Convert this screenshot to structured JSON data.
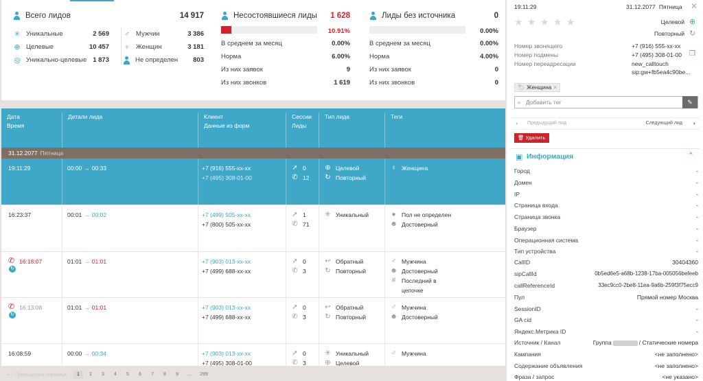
{
  "stats": {
    "col1": {
      "title": "Всего лидов",
      "total": "14 917",
      "left": [
        {
          "label": "Уникальные",
          "value": "2 569",
          "icon": "asterisk-icon"
        },
        {
          "label": "Целевые",
          "value": "10 457",
          "icon": "target-icon"
        },
        {
          "label": "Уникально-целевые",
          "value": "1 873",
          "icon": "unique-target-icon"
        }
      ],
      "right": [
        {
          "label": "Мужчин",
          "value": "3 386",
          "icon": "male-icon"
        },
        {
          "label": "Женщин",
          "value": "3 181",
          "icon": "female-icon"
        },
        {
          "label": "Не определен",
          "value": "803",
          "icon": "person-icon"
        }
      ]
    },
    "col2": {
      "title": "Несостоявшиеся лиды",
      "total": "1 628",
      "percent": "10.91%",
      "bar_fraction": 0.1091,
      "items": [
        {
          "label": "В среднем за месяц",
          "value": "0.00%"
        },
        {
          "label": "Норма",
          "value": "6.00%"
        },
        {
          "label": "Из них заявок",
          "value": "9"
        },
        {
          "label": "Из них звонков",
          "value": "1 619"
        }
      ]
    },
    "col3": {
      "title": "Лиды без источника",
      "total": "0",
      "percent": "0.00%",
      "bar_fraction": 0,
      "items": [
        {
          "label": "В среднем за месяц",
          "value": "0.00%"
        },
        {
          "label": "Норма",
          "value": "4.00%"
        },
        {
          "label": "Из них заявок",
          "value": "0"
        },
        {
          "label": "Из них звонков",
          "value": "0"
        }
      ]
    }
  },
  "table": {
    "headers": {
      "date_time": [
        "Дата",
        "Время"
      ],
      "details": "Детали лида",
      "client": [
        "Клиент",
        "Данные из форм"
      ],
      "sessions": [
        "Сессии",
        "Лиды"
      ],
      "type": "Тип лида",
      "tags": "Теги"
    },
    "day": {
      "date": "31.12.2077",
      "weekday": "Пятница"
    },
    "rows": [
      {
        "time": "19:11:29",
        "missed": false,
        "dur_a": "00:00",
        "dur_b": "00:33",
        "dur_b_red": false,
        "phone1": "+7 (916) 555-xx-xx",
        "phone2": "+7 (495) 308-01-00",
        "sessions": "0",
        "calls": "12",
        "types": [
          {
            "icon": "target-icon",
            "label": "Целевой"
          },
          {
            "icon": "repeat-icon",
            "label": "Повторный"
          }
        ],
        "tags": [
          {
            "icon": "female-icon",
            "label": "Женщина"
          }
        ]
      },
      {
        "time": "16:23:37",
        "missed": false,
        "dur_a": "00:01",
        "dur_b": "00:02",
        "dur_b_red": false,
        "phone1": "+7 (499) 505-xx-xx",
        "phone2": "+7 (800) 505-xx-xx",
        "sessions": "1",
        "calls": "71",
        "types": [
          {
            "icon": "asterisk-icon",
            "label": "Уникальный"
          }
        ],
        "tags": [
          {
            "icon": "person-icon",
            "label": "Пол не определен"
          },
          {
            "icon": "robot-icon",
            "label": "Достоверный"
          }
        ]
      },
      {
        "time": "16:18:07",
        "missed": true,
        "dur_a": "01:01",
        "dur_b": "01:01",
        "dur_b_red": true,
        "phone1": "+7 (903) 013-xx-xx",
        "phone2": "+7 (499) 688-xx-xx",
        "sessions": "0",
        "calls": "3",
        "types": [
          {
            "icon": "callback-icon",
            "label": "Обратный"
          },
          {
            "icon": "repeat-icon",
            "label": "Повторный"
          }
        ],
        "tags": [
          {
            "icon": "male-icon",
            "label": "Мужчина"
          },
          {
            "icon": "robot-icon",
            "label": "Достоверный"
          },
          {
            "icon": "hash-icon",
            "label": "Последний в"
          },
          {
            "icon": "",
            "label": "цепочке"
          }
        ]
      },
      {
        "time": "16:13:08",
        "missed": true,
        "dur_a": "01:01",
        "dur_b": "01:01",
        "dur_b_red": true,
        "phone1": "+7 (903) 013-xx-xx",
        "phone2": "+7 (499) 688-xx-xx",
        "sessions": "0",
        "calls": "3",
        "types": [
          {
            "icon": "callback-icon",
            "label": "Обратный"
          },
          {
            "icon": "repeat-icon",
            "label": "Повторный"
          }
        ],
        "tags": [
          {
            "icon": "male-icon",
            "label": "Мужчина"
          },
          {
            "icon": "robot-icon",
            "label": "Достоверный"
          }
        ]
      },
      {
        "time": "16:08:59",
        "missed": false,
        "dur_a": "00:00",
        "dur_b": "00:34",
        "dur_b_red": false,
        "phone1": "+7 (903) 013-xx-xx",
        "phone2": "+7 (495) 308-01-00",
        "sessions": "0",
        "calls": "3",
        "types": [
          {
            "icon": "asterisk-icon",
            "label": "Уникальный"
          },
          {
            "icon": "target-icon",
            "label": "Целевой"
          }
        ],
        "tags": [
          {
            "icon": "male-icon",
            "label": "Мужчина"
          }
        ]
      }
    ]
  },
  "pager": {
    "prev": "Предыдущая страница",
    "pages": [
      "1",
      "2",
      "3",
      "4",
      "5",
      "6",
      "7",
      "8",
      "9",
      "...",
      "299"
    ],
    "current": "1"
  },
  "side": {
    "time": "19:11:29",
    "date": "31.12.2077",
    "weekday": "Пятница",
    "lead_types": [
      {
        "label": "Целевой",
        "icon": "target-icon"
      },
      {
        "label": "Повторный",
        "icon": "repeat-icon"
      }
    ],
    "numbers": [
      {
        "label": "Номер звонящего",
        "value": "+7 (916) 555-xx-xx"
      },
      {
        "label": "Номер подмены",
        "value": "+7 (495) 308-01-00"
      },
      {
        "label": "Номер переадресации",
        "value": "new_calltouch"
      },
      {
        "label": "",
        "value": "sip:gw+fb5ea4c90be..."
      }
    ],
    "tag": "Женщина",
    "tag_placeholder": "Добавить тег",
    "prev_lead": "Предыдущий лид",
    "next_lead": "Следующий лид",
    "delete": "Удалить",
    "info_title": "Информация",
    "info": [
      {
        "label": "Город",
        "value": "-"
      },
      {
        "label": "Домен",
        "value": "-"
      },
      {
        "label": "IP",
        "value": "-"
      },
      {
        "label": "Страница входа",
        "value": "-"
      },
      {
        "label": "Страница звонка",
        "value": "-"
      },
      {
        "label": "Браузер",
        "value": "-"
      },
      {
        "label": "Операционная система",
        "value": "-"
      },
      {
        "label": "Тип устройства",
        "value": "-"
      },
      {
        "label": "CallID",
        "value": "30404360"
      },
      {
        "label": "sipCallId",
        "value": "0b5ed6e5-a68b-1238-17ba-005056befeeb"
      },
      {
        "label": "callReferenceId",
        "value": "33ec9cc0-2be8-11ea-9a6b-259f3f75ecc9"
      },
      {
        "label": "Пул",
        "value": "Прямой номер Москва"
      },
      {
        "label": "SessionID",
        "value": "-"
      },
      {
        "label": "GA cid",
        "value": "-"
      },
      {
        "label": "Яндекс.Метрика ID",
        "value": "-"
      },
      {
        "label": "Источник / Канал",
        "value_prefix": "Группа",
        "value": "/ Статические номера"
      },
      {
        "label": "Кампания",
        "value": "<не заполнено>"
      },
      {
        "label": "Содержание объявления",
        "value": "<не заполнено>"
      },
      {
        "label": "Фраза / запрос",
        "value": "<не указано>"
      }
    ]
  },
  "colors": {
    "accent": "#3fa7c8",
    "danger": "#d0252c",
    "day_bar": "#7d6f63"
  }
}
